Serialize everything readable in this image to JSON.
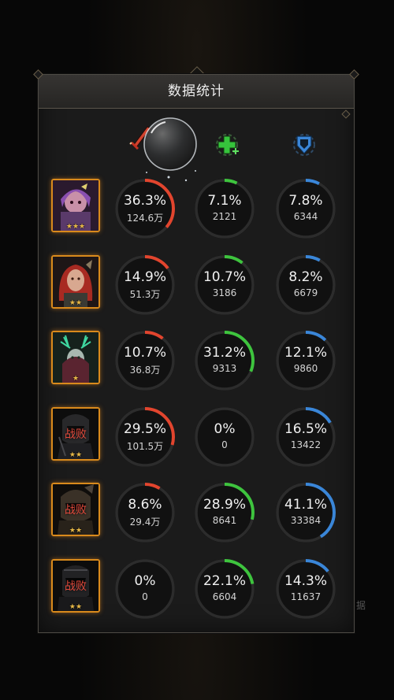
{
  "panel": {
    "title": "数据统计"
  },
  "side_text": "据",
  "columns": [
    {
      "icon": "sword-damage-icon",
      "color": "#e2452e"
    },
    {
      "icon": "healing-plus-icon",
      "color": "#3ec43e"
    },
    {
      "icon": "shield-defense-icon",
      "color": "#3a86d8"
    }
  ],
  "defeated_label": "战败",
  "heroes": [
    {
      "stars": "★★★",
      "defeated": false,
      "portrait": "hero-1",
      "stats": [
        {
          "percent": "36.3%",
          "value": "124.6万",
          "fraction": 0.363
        },
        {
          "percent": "7.1%",
          "value": "2121",
          "fraction": 0.071
        },
        {
          "percent": "7.8%",
          "value": "6344",
          "fraction": 0.078
        }
      ]
    },
    {
      "stars": "★★",
      "defeated": false,
      "portrait": "hero-2",
      "stats": [
        {
          "percent": "14.9%",
          "value": "51.3万",
          "fraction": 0.149
        },
        {
          "percent": "10.7%",
          "value": "3186",
          "fraction": 0.107
        },
        {
          "percent": "8.2%",
          "value": "6679",
          "fraction": 0.082
        }
      ]
    },
    {
      "stars": "★",
      "defeated": false,
      "portrait": "hero-3",
      "stats": [
        {
          "percent": "10.7%",
          "value": "36.8万",
          "fraction": 0.107
        },
        {
          "percent": "31.2%",
          "value": "9313",
          "fraction": 0.312
        },
        {
          "percent": "12.1%",
          "value": "9860",
          "fraction": 0.121
        }
      ]
    },
    {
      "stars": "★★",
      "defeated": true,
      "portrait": "hero-4",
      "stats": [
        {
          "percent": "29.5%",
          "value": "101.5万",
          "fraction": 0.295
        },
        {
          "percent": "0%",
          "value": "0",
          "fraction": 0
        },
        {
          "percent": "16.5%",
          "value": "13422",
          "fraction": 0.165
        }
      ]
    },
    {
      "stars": "★★",
      "defeated": true,
      "portrait": "hero-5",
      "stats": [
        {
          "percent": "8.6%",
          "value": "29.4万",
          "fraction": 0.086
        },
        {
          "percent": "28.9%",
          "value": "8641",
          "fraction": 0.289
        },
        {
          "percent": "41.1%",
          "value": "33384",
          "fraction": 0.411
        }
      ]
    },
    {
      "stars": "★★",
      "defeated": true,
      "portrait": "hero-6",
      "stats": [
        {
          "percent": "0%",
          "value": "0",
          "fraction": 0
        },
        {
          "percent": "22.1%",
          "value": "6604",
          "fraction": 0.221
        },
        {
          "percent": "14.3%",
          "value": "11637",
          "fraction": 0.143
        }
      ]
    }
  ]
}
